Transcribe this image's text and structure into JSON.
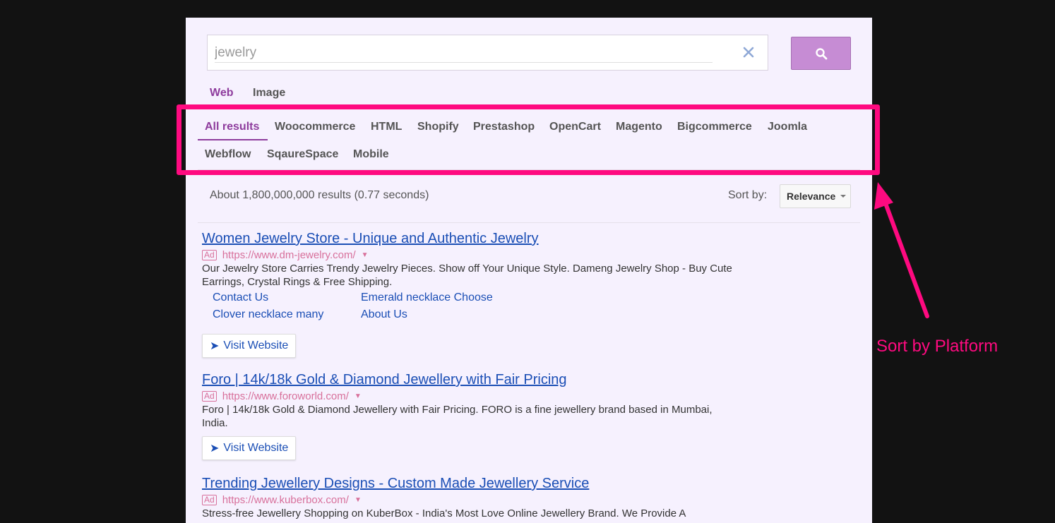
{
  "search": {
    "value": "jewelry",
    "clear_icon": "close-icon",
    "button_icon": "search-icon"
  },
  "type_tabs": [
    {
      "label": "Web",
      "active": true
    },
    {
      "label": "Image",
      "active": false
    }
  ],
  "platform_tabs": [
    {
      "label": "All results",
      "active": true
    },
    {
      "label": "Woocommerce"
    },
    {
      "label": "HTML"
    },
    {
      "label": "Shopify"
    },
    {
      "label": "Prestashop"
    },
    {
      "label": "OpenCart"
    },
    {
      "label": "Magento"
    },
    {
      "label": "Bigcommerce"
    },
    {
      "label": "Joomla"
    },
    {
      "label": "Webflow"
    },
    {
      "label": "SqaureSpace"
    },
    {
      "label": "Mobile"
    }
  ],
  "results_info": "About 1,800,000,000 results (0.77 seconds)",
  "sort": {
    "label": "Sort by:",
    "selected": "Relevance"
  },
  "results": [
    {
      "title": "Women Jewelry Store - Unique and Authentic Jewelry",
      "ad": "Ad",
      "url": "https://www.dm-jewelry.com/",
      "description": "Our Jewelry Store Carries Trendy Jewelry Pieces. Show off Your Unique Style. Dameng Jewelry Shop - Buy Cute Earrings, Crystal Rings & Free Shipping.",
      "sitelinks": [
        "Contact Us",
        "Emerald necklace Choose",
        "Clover necklace many",
        "About Us"
      ],
      "button": "Visit Website"
    },
    {
      "title": "Foro | 14k/18k Gold & Diamond Jewellery with Fair Pricing",
      "ad": "Ad",
      "url": "https://www.foroworld.com/",
      "description": "Foro | 14k/18k Gold & Diamond Jewellery with Fair Pricing. FORO is a fine jewellery brand based in Mumbai, India.",
      "button": "Visit Website"
    },
    {
      "title": "Trending Jewellery Designs - Custom Made Jewellery Service",
      "ad": "Ad",
      "url": "https://www.kuberbox.com/",
      "description": "Stress-free Jewellery Shopping on KuberBox - India's Most Love Online Jewellery Brand. We Provide A"
    }
  ],
  "annotation": {
    "label": "Sort by Platform",
    "color": "#ff0a80"
  },
  "colors": {
    "accent": "#8e3c9d",
    "search_button": "#c68cd4",
    "link": "#1a4eb5",
    "ad": "#d8709b",
    "panel": "#f6f1fe",
    "backdrop": "#121212"
  }
}
